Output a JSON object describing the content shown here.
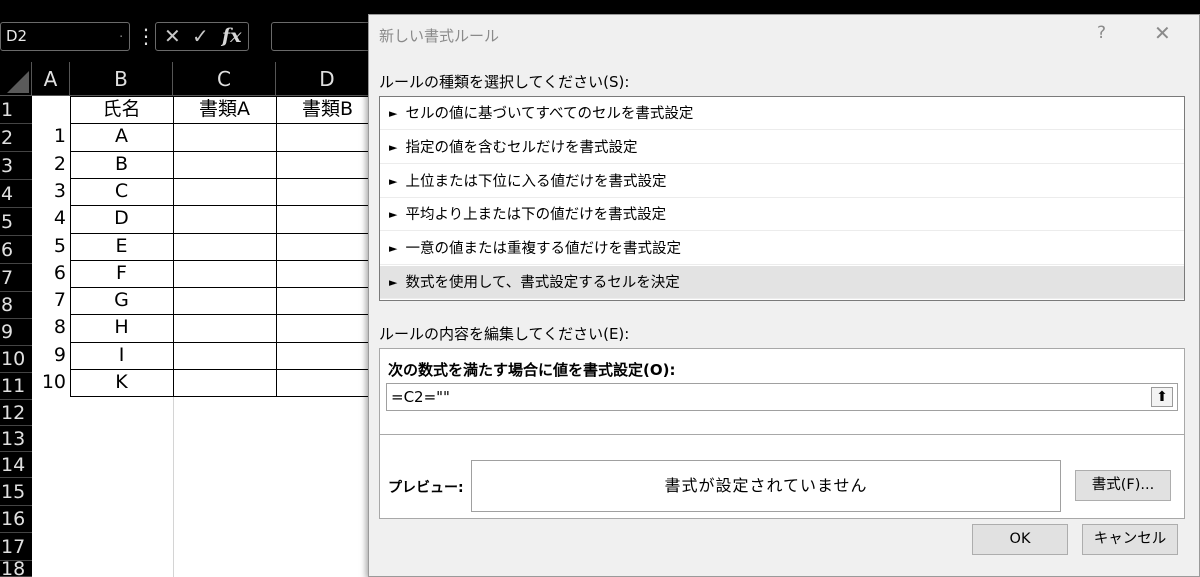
{
  "formula_bar": {
    "name_box": "D2",
    "cancel_glyph": "✕",
    "enter_glyph": "✓",
    "fx_glyph": "fx"
  },
  "columns": [
    "A",
    "B",
    "C",
    "D"
  ],
  "rows": [
    "1",
    "2",
    "3",
    "4",
    "5",
    "6",
    "7",
    "8",
    "9",
    "10",
    "11",
    "12",
    "13",
    "14",
    "15",
    "16",
    "17",
    "18"
  ],
  "sheet": {
    "header": {
      "b": "氏名",
      "c": "書類A",
      "d": "書類B"
    },
    "data": [
      {
        "a": "1",
        "b": "A"
      },
      {
        "a": "2",
        "b": "B"
      },
      {
        "a": "3",
        "b": "C"
      },
      {
        "a": "4",
        "b": "D"
      },
      {
        "a": "5",
        "b": "E"
      },
      {
        "a": "6",
        "b": "F"
      },
      {
        "a": "7",
        "b": "G"
      },
      {
        "a": "8",
        "b": "H"
      },
      {
        "a": "9",
        "b": "I"
      },
      {
        "a": "10",
        "b": "K"
      }
    ]
  },
  "dialog": {
    "title": "新しい書式ルール",
    "help": "?",
    "close": "✕",
    "rule_type_label": "ルールの種類を選択してください(S):",
    "rule_types": [
      "セルの値に基づいてすべてのセルを書式設定",
      "指定の値を含むセルだけを書式設定",
      "上位または下位に入る値だけを書式設定",
      "平均より上または下の値だけを書式設定",
      "一意の値または重複する値だけを書式設定",
      "数式を使用して、書式設定するセルを決定"
    ],
    "selected_rule_index": 5,
    "edit_label": "ルールの内容を編集してください(E):",
    "formula_label": "次の数式を満たす場合に値を書式設定(O):",
    "formula_value": "=C2=\"\"",
    "collapse_glyph": "⬆",
    "preview_label": "プレビュー:",
    "preview_text": "書式が設定されていません",
    "format_button": "書式(F)...",
    "ok_button": "OK",
    "cancel_button": "キャンセル"
  }
}
